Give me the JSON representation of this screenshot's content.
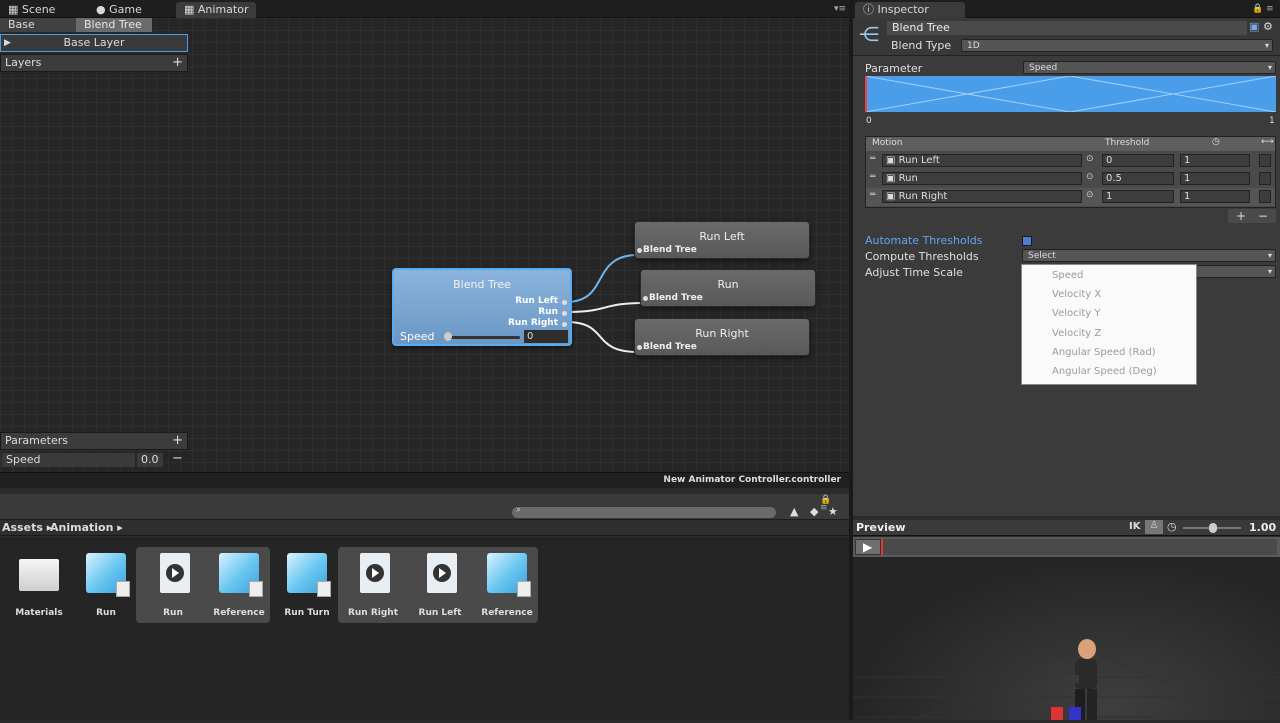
{
  "tabs": {
    "scene": "Scene",
    "game": "Game",
    "animator": "Animator",
    "inspector": "Inspector"
  },
  "breadcrumb": [
    "Base Layer",
    "Blend Tree"
  ],
  "left_panel": {
    "base_layer": "Base Layer",
    "layers_header": "Layers",
    "parameters_header": "Parameters",
    "parameter_name": "Speed",
    "parameter_value": "0.0"
  },
  "graph": {
    "blend_node": {
      "title": "Blend Tree",
      "outputs": [
        "Run Left",
        "Run",
        "Run Right"
      ],
      "param_label": "Speed",
      "param_value": "0"
    },
    "child_nodes": [
      {
        "title": "Run Left",
        "sub": "Blend Tree"
      },
      {
        "title": "Run",
        "sub": "Blend Tree"
      },
      {
        "title": "Run Right",
        "sub": "Blend Tree"
      }
    ]
  },
  "statusbar": "New Animator Controller.controller",
  "project": {
    "crumbs": [
      "Assets ▸",
      "Animation ▸"
    ],
    "assets": [
      {
        "label": "Materials",
        "kind": "folder-icon"
      },
      {
        "label": "Run",
        "kind": "model-icon"
      },
      {
        "label": "Run",
        "kind": "clip-icon"
      },
      {
        "label": "Reference",
        "kind": "model-icon"
      },
      {
        "label": "Run Turn",
        "kind": "model-icon"
      },
      {
        "label": "Run Right",
        "kind": "clip-icon"
      },
      {
        "label": "Run Left",
        "kind": "clip-icon"
      },
      {
        "label": "Reference",
        "kind": "model-icon"
      }
    ]
  },
  "inspector": {
    "object_name": "Blend Tree",
    "blend_type_label": "Blend Type",
    "blend_type_value": "1D",
    "parameter_label": "Parameter",
    "parameter_value": "Speed",
    "graph_min": "0",
    "graph_max": "1",
    "table_headers": {
      "motion": "Motion",
      "threshold": "Threshold"
    },
    "motions": [
      {
        "name": "Run Left",
        "threshold": "0",
        "speed": "1"
      },
      {
        "name": "Run",
        "threshold": "0.5",
        "speed": "1"
      },
      {
        "name": "Run Right",
        "threshold": "1",
        "speed": "1"
      }
    ],
    "automate_thresholds": "Automate Thresholds",
    "compute_thresholds": "Compute Thresholds",
    "compute_value": "Select",
    "adjust_time_scale": "Adjust Time Scale",
    "popup_options": [
      "Speed",
      "Velocity X",
      "Velocity Y",
      "Velocity Z",
      "Angular Speed (Rad)",
      "Angular Speed (Deg)"
    ]
  },
  "preview": {
    "title": "Preview",
    "ik": "IK",
    "speed_value": "1.00"
  },
  "colors": {
    "accent": "#4e9be6",
    "node_selected": "#7da9d6",
    "node": "#636363"
  }
}
